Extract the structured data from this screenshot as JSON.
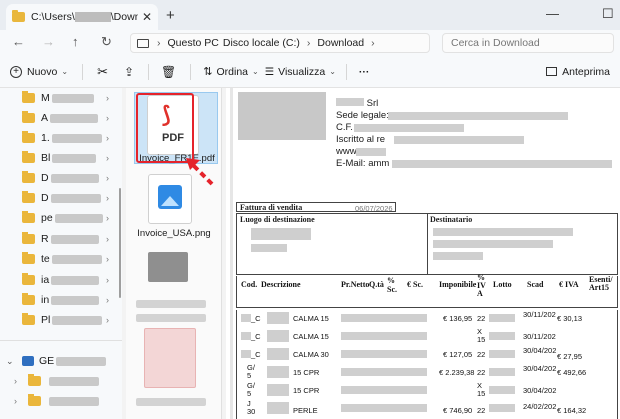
{
  "window": {
    "tab_title": "C:\\Users\\",
    "tab_title_suffix": "\\Downloads",
    "new_tab": "+",
    "minimize": "—",
    "maximize": "☐",
    "close": "✕"
  },
  "address": {
    "crumbs": [
      "Questo PC",
      "Disco locale (C:)",
      "Download"
    ],
    "search_placeholder": "Cerca in Download"
  },
  "toolbar": {
    "new_label": "Nuovo",
    "sort_label": "Ordina",
    "view_label": "Visualizza",
    "more_label": "···",
    "preview_label": "Anteprima"
  },
  "nav_pane": {
    "items": [
      "M",
      "A",
      "1.",
      "Bl",
      "D",
      "D",
      "pe",
      "R",
      "te",
      "ia",
      "in",
      "Pl"
    ],
    "bottom_item": "GE"
  },
  "files": [
    {
      "name": "Invoice_FR1E.pdf",
      "type": "pdf",
      "selected": true
    },
    {
      "name": "Invoice_USA.png",
      "type": "image",
      "selected": false
    }
  ],
  "preview_doc": {
    "company": "Srl",
    "sede": "Sede legale:",
    "cf": "C.F.",
    "iscritto": "Iscritto al re",
    "www": "www.",
    "email": "E-Mail: amm",
    "fattura_label": "Fattura di vendita",
    "fattura_date": "06/07/2026",
    "luogo": "Luogo di destinazione",
    "destinatario": "Destinatario",
    "headers": [
      "Cod.",
      "Descrizione",
      "Pr.Netto",
      "Q.tà",
      "%\nSc.",
      "€ Sc.",
      "Imponibile",
      "%\nIV\nA",
      "Lotto",
      "Scad",
      "€ IVA",
      "Esenti/\nArt15"
    ],
    "rows": [
      {
        "code": "_C",
        "desc": "CALMA 15",
        "imponibile": "€ 136,95",
        "iva": "22",
        "lotto": "",
        "scad": "30/11/202",
        "eiva": "€ 30,13"
      },
      {
        "code": "_C",
        "desc": "CALMA 15",
        "imponibile": "",
        "iva": "X\n15",
        "lotto": "",
        "scad": "30/11/202",
        "eiva": ""
      },
      {
        "code": "_C",
        "desc": "CALMA 30",
        "imponibile": "€ 127,05",
        "iva": "22",
        "lotto": "",
        "scad": "30/04/202",
        "eiva": "€ 27,95"
      },
      {
        "code": "G/\n5",
        "desc": "15 CPR",
        "imponibile": "€ 2.239,38",
        "iva": "22",
        "lotto": "",
        "scad": "30/04/202",
        "eiva": "€ 492,66"
      },
      {
        "code": "G/\n5",
        "desc": "15 CPR",
        "imponibile": "",
        "iva": "X\n15",
        "lotto": "",
        "scad": "30/04/202",
        "eiva": ""
      },
      {
        "code": "J\n30",
        "desc": "PERLE",
        "imponibile": "€ 746,90",
        "iva": "22",
        "lotto": "",
        "scad": "24/02/202",
        "eiva": "€ 164,32"
      }
    ]
  }
}
